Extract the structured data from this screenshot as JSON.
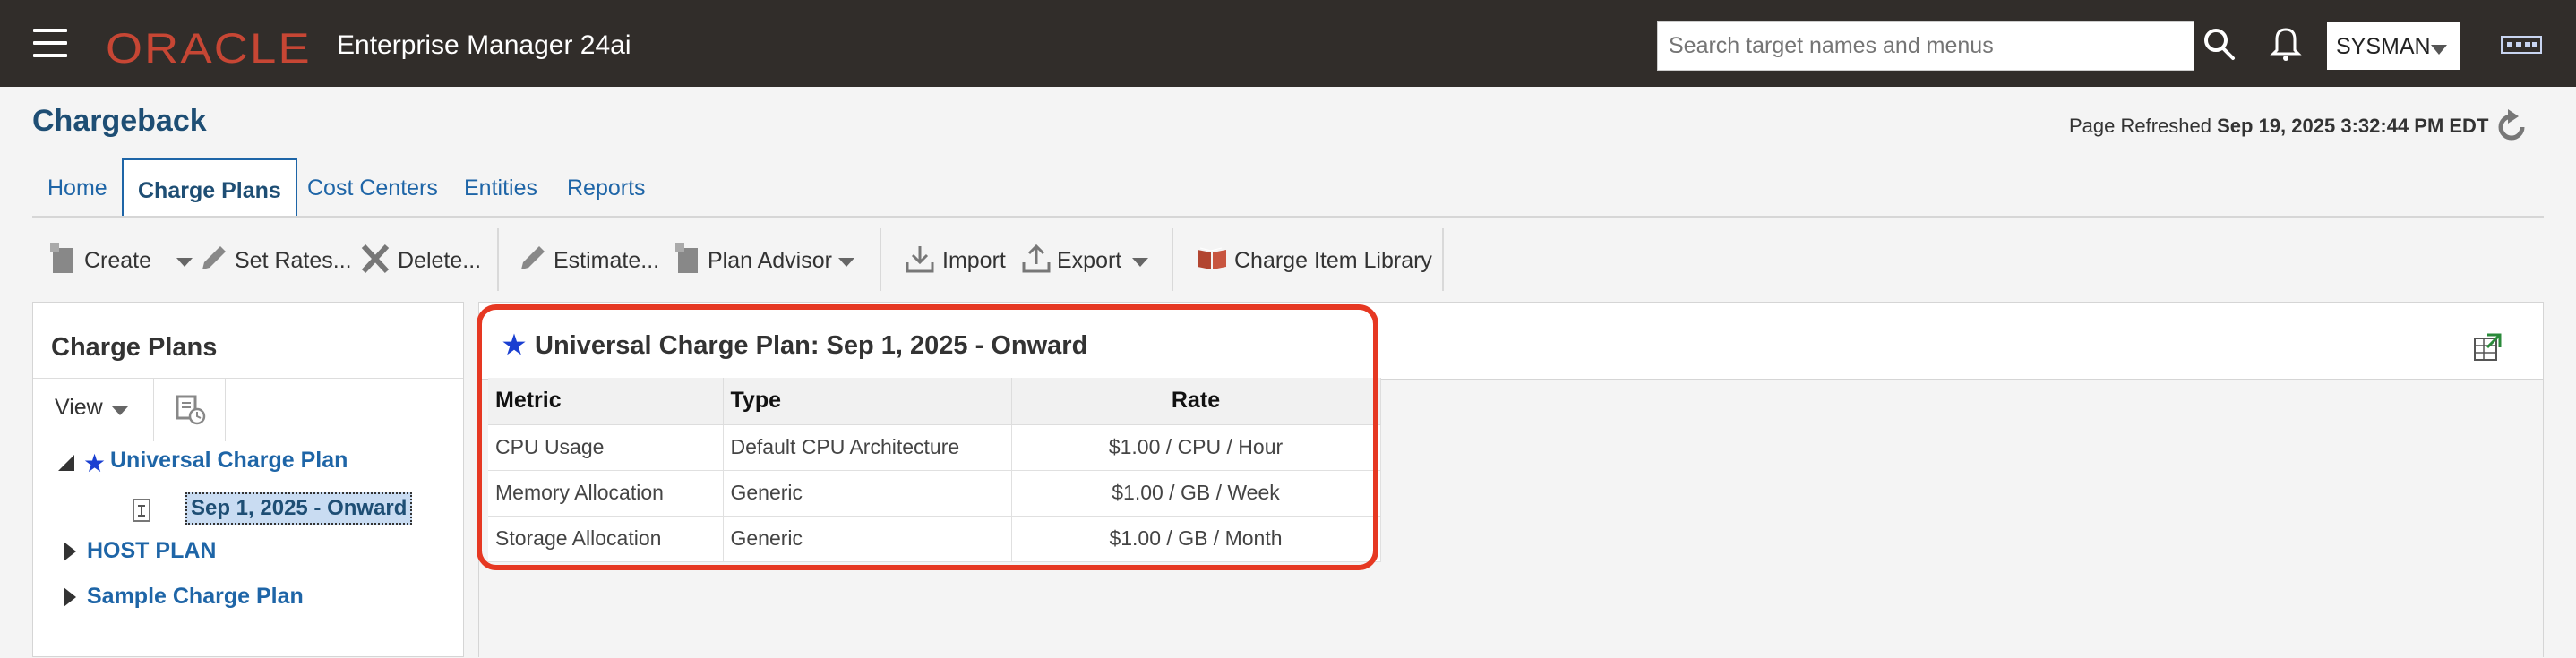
{
  "app": {
    "logo": "ORACLE",
    "product": "Enterprise Manager 24ai",
    "search_placeholder": "Search target names and menus",
    "user": "SYSMAN"
  },
  "page": {
    "title": "Chargeback",
    "refresh_label": "Page Refreshed",
    "refresh_time": "Sep 19, 2025 3:32:44 PM EDT"
  },
  "tabs": [
    {
      "label": "Home"
    },
    {
      "label": "Charge Plans",
      "active": true
    },
    {
      "label": "Cost Centers"
    },
    {
      "label": "Entities"
    },
    {
      "label": "Reports"
    }
  ],
  "toolbar": {
    "create": "Create",
    "set_rates": "Set Rates...",
    "delete": "Delete...",
    "estimate": "Estimate...",
    "plan_advisor": "Plan Advisor",
    "import": "Import",
    "export": "Export",
    "charge_item_library": "Charge Item Library"
  },
  "left_panel": {
    "title": "Charge Plans",
    "view_label": "View",
    "tree": [
      {
        "label": "Universal Charge Plan",
        "expanded": true,
        "children": [
          {
            "label": "Sep 1, 2025 - Onward",
            "selected": true
          }
        ]
      },
      {
        "label": "HOST PLAN",
        "expanded": false
      },
      {
        "label": "Sample Charge Plan",
        "expanded": false
      }
    ]
  },
  "plan": {
    "title": "Universal Charge Plan: Sep 1, 2025 - Onward",
    "columns": [
      "Metric",
      "Type",
      "Rate"
    ],
    "rows": [
      {
        "metric": "CPU Usage",
        "type": "Default CPU Architecture",
        "amount": "$1.00",
        "unit": "CPU",
        "period": "Hour"
      },
      {
        "metric": "Memory Allocation",
        "type": "Generic",
        "amount": "$1.00",
        "unit": "GB",
        "period": "Week"
      },
      {
        "metric": "Storage Allocation",
        "type": "Generic",
        "amount": "$1.00",
        "unit": "GB",
        "period": "Month"
      }
    ]
  },
  "colors": {
    "header_bg": "#312d2a",
    "oracle_red": "#c74634",
    "link_blue": "#1e65a7",
    "title_blue": "#1e4e74",
    "highlight": "#e63822"
  }
}
